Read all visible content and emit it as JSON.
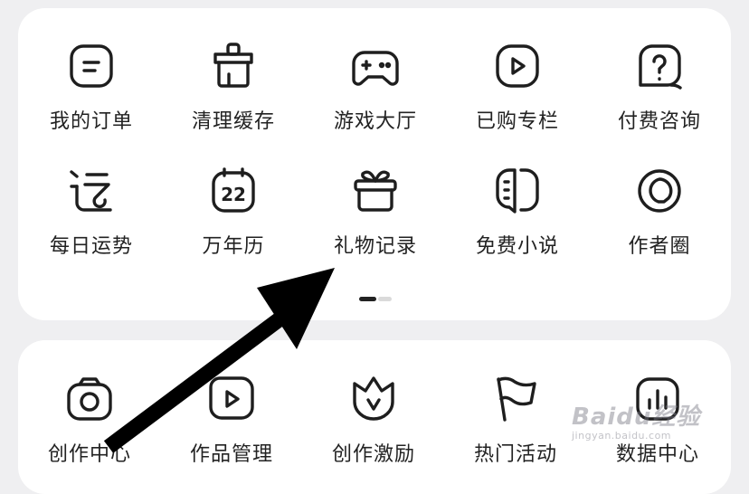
{
  "grid1": {
    "row1": [
      {
        "label": "我的订单",
        "icon": "orders-icon"
      },
      {
        "label": "清理缓存",
        "icon": "broom-icon"
      },
      {
        "label": "游戏大厅",
        "icon": "gamepad-icon"
      },
      {
        "label": "已购专栏",
        "icon": "play-icon"
      },
      {
        "label": "付费咨询",
        "icon": "question-chat-icon"
      }
    ],
    "row2": [
      {
        "label": "每日运势",
        "icon": "fortune-icon"
      },
      {
        "label": "万年历",
        "icon": "calendar-icon",
        "badge": "22"
      },
      {
        "label": "礼物记录",
        "icon": "gift-icon"
      },
      {
        "label": "免费小说",
        "icon": "book-icon"
      },
      {
        "label": "作者圈",
        "icon": "circle-icon"
      }
    ]
  },
  "pager": {
    "pages": 2,
    "active": 1
  },
  "grid2": {
    "row1": [
      {
        "label": "创作中心",
        "icon": "camera-icon"
      },
      {
        "label": "作品管理",
        "icon": "video-icon"
      },
      {
        "label": "创作激励",
        "icon": "crown-icon"
      },
      {
        "label": "热门活动",
        "icon": "flag-icon"
      },
      {
        "label": "数据中心",
        "icon": "chart-icon"
      }
    ]
  },
  "watermark": {
    "main": "Baidu经验",
    "sub": "jingyan.baidu.com"
  }
}
